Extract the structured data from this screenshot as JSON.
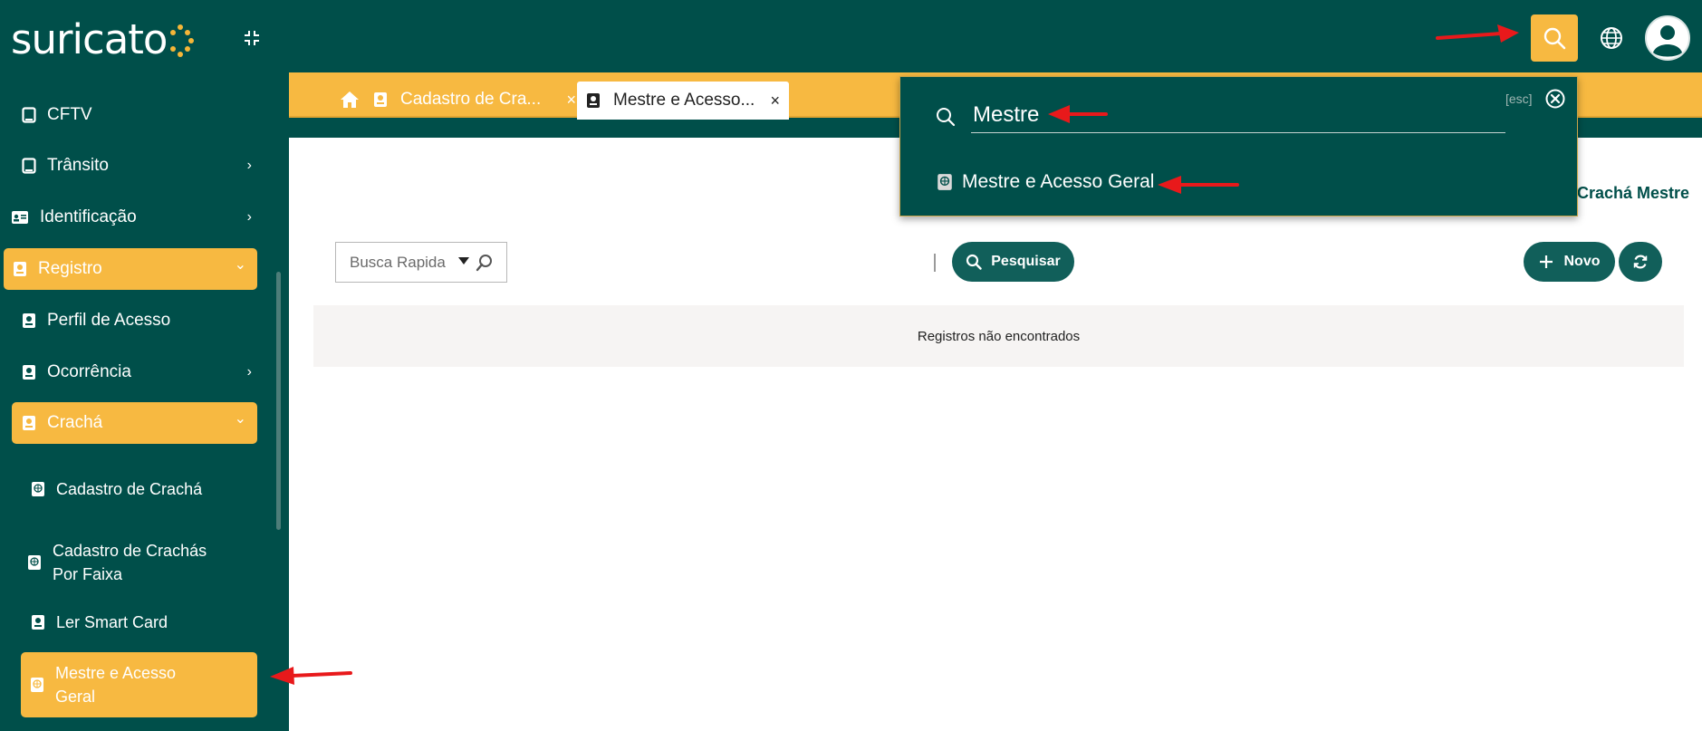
{
  "app": {
    "logo_text": "suricato",
    "brand_color": "#004f4a",
    "accent_color": "#f7b941",
    "annotation_color": "#e8191b"
  },
  "sidebar": {
    "items": [
      {
        "label": "CFTV",
        "icon": "tablet-icon",
        "active": false,
        "chevron": ""
      },
      {
        "label": "Trânsito",
        "icon": "tablet-icon",
        "active": false,
        "chevron": "›"
      },
      {
        "label": "Identificação",
        "icon": "id-card-icon",
        "active": false,
        "chevron": "›"
      },
      {
        "label": "Registro",
        "icon": "badge-icon",
        "active": true,
        "chevron": "⌄"
      },
      {
        "label": "Perfil de Acesso",
        "icon": "badge-icon",
        "active": false,
        "chevron": ""
      },
      {
        "label": "Ocorrência",
        "icon": "badge-icon",
        "active": false,
        "chevron": "›"
      },
      {
        "label": "Crachá",
        "icon": "badge-icon",
        "active": true,
        "chevron": "⌄"
      },
      {
        "label": "Cadastro de Crachá",
        "icon": "globe-badge-icon",
        "active": false,
        "chevron": ""
      },
      {
        "label": "Cadastro de Crachás Por Faixa",
        "icon": "globe-badge-icon",
        "active": false,
        "chevron": ""
      },
      {
        "label": "Ler Smart Card",
        "icon": "badge-icon",
        "active": false,
        "chevron": ""
      },
      {
        "label": "Mestre e Acesso Geral",
        "icon": "globe-badge-icon",
        "active": true,
        "chevron": ""
      }
    ]
  },
  "tabs": [
    {
      "label": "Cadastro de Cra...",
      "close": "×"
    },
    {
      "label": "Mestre e Acesso...",
      "close": "×"
    }
  ],
  "page": {
    "breadcrumb_tail": "Crachá Mestre",
    "quick_search_placeholder": "Busca Rapida",
    "search_button": "Pesquisar",
    "new_button": "Novo",
    "empty_message": "Registros não encontrados"
  },
  "search_popup": {
    "query": "Mestre",
    "esc_hint": "[esc]",
    "results": [
      {
        "label": "Mestre e Acesso Geral",
        "icon": "globe-badge-icon"
      }
    ]
  }
}
